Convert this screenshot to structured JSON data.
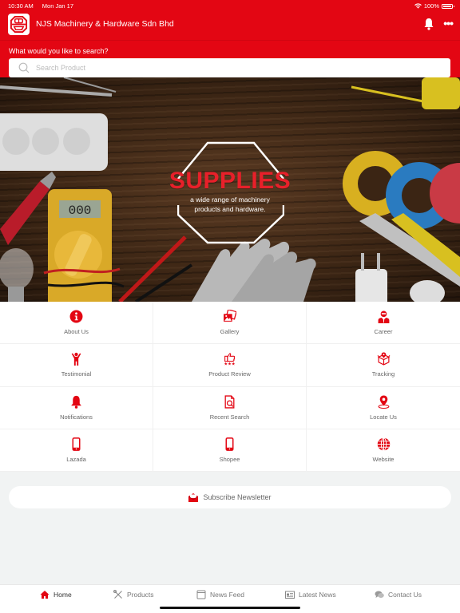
{
  "status_bar": {
    "time": "10:30 AM",
    "date": "Mon Jan 17",
    "battery": "100%"
  },
  "app_bar": {
    "title": "NJS Machinery & Hardware Sdn Bhd",
    "more_label": "•••"
  },
  "search": {
    "label": "What would you like to search?",
    "placeholder": "Search Product",
    "value": ""
  },
  "banner": {
    "title": "SUPPLIES",
    "subtitle_line1": "a wide range of machinery",
    "subtitle_line2": "products and hardware."
  },
  "menu": [
    {
      "label": "About Us",
      "icon": "info-icon"
    },
    {
      "label": "Gallery",
      "icon": "gallery-icon"
    },
    {
      "label": "Career",
      "icon": "career-icon"
    },
    {
      "label": "Testimonial",
      "icon": "testimonial-icon"
    },
    {
      "label": "Product Review",
      "icon": "product-review-icon"
    },
    {
      "label": "Tracking",
      "icon": "tracking-icon"
    },
    {
      "label": "Notifications",
      "icon": "bell-icon"
    },
    {
      "label": "Recent Search",
      "icon": "recent-search-icon"
    },
    {
      "label": "Locate Us",
      "icon": "location-pin-icon"
    },
    {
      "label": "Lazada",
      "icon": "phone-icon"
    },
    {
      "label": "Shopee",
      "icon": "phone-icon"
    },
    {
      "label": "Website",
      "icon": "globe-icon"
    }
  ],
  "newsletter": {
    "label": "Subscribe Newsletter"
  },
  "tabs": [
    {
      "label": "Home",
      "active": true
    },
    {
      "label": "Products",
      "active": false
    },
    {
      "label": "News Feed",
      "active": false
    },
    {
      "label": "Latest News",
      "active": false
    },
    {
      "label": "Contact Us",
      "active": false
    }
  ],
  "colors": {
    "brand_red": "#e30613",
    "background": "#f1f3f3",
    "label_gray": "#666666"
  }
}
